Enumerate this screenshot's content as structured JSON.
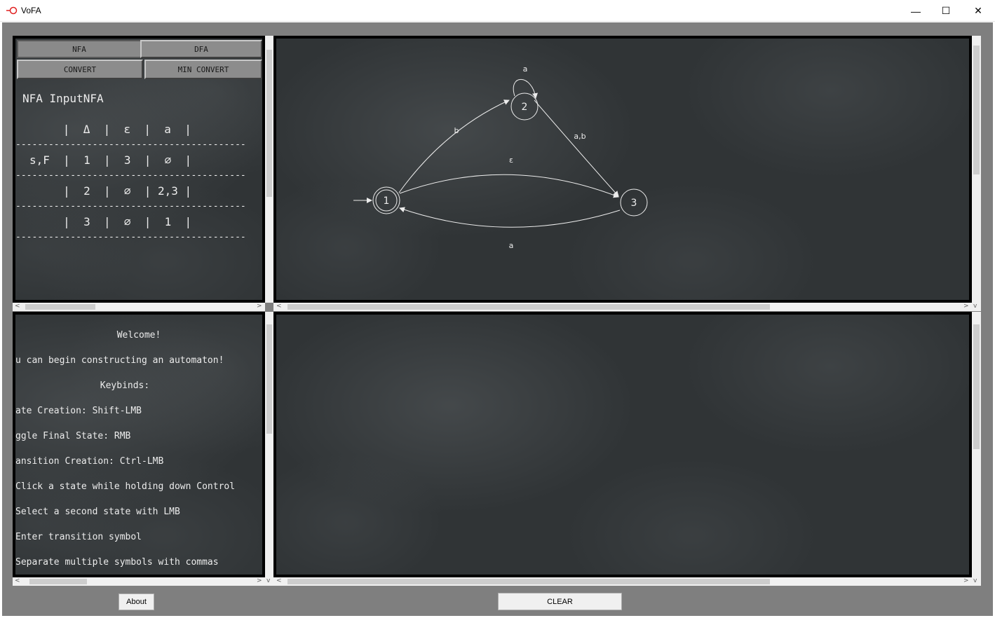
{
  "window": {
    "title": "VoFA",
    "minimize_glyph": "—",
    "maximize_glyph": "☐",
    "close_glyph": "✕"
  },
  "controls": {
    "nfa_label": "NFA",
    "dfa_label": "DFA",
    "convert_label": "CONVERT",
    "min_convert_label": "MIN CONVERT"
  },
  "table": {
    "title": "NFA InputNFA",
    "header": "      |  Δ  |  ε  |  a  |",
    "rows": [
      "s,F  |  1  |  3  |  ∅  |",
      "     |  2  |  ∅  | 2,3 |",
      "     |  3  |  ∅  |  1  |"
    ],
    "separator": "------------------------------------------"
  },
  "graph": {
    "states": [
      "1",
      "2",
      "3"
    ],
    "labels": {
      "self_loop_2": "a",
      "edge_1_2": "b",
      "edge_2_3": "a,b",
      "edge_1_3": "ε",
      "edge_3_1": "a"
    }
  },
  "help": {
    "lines": [
      "Welcome!",
      "u can begin constructing an automaton!",
      "Keybinds:",
      "ate Creation: Shift-LMB",
      "ggle Final State: RMB",
      "ansition Creation: Ctrl-LMB",
      "Click a state while holding down Control",
      "Select a second state with LMB",
      "Enter transition symbol",
      "Separate multiple symbols with commas"
    ]
  },
  "footer": {
    "about_label": "About",
    "clear_label": "CLEAR"
  },
  "colors": {
    "chalkboard": "#303436",
    "frame": "#7f7f7f",
    "chalk": "#ececec"
  }
}
